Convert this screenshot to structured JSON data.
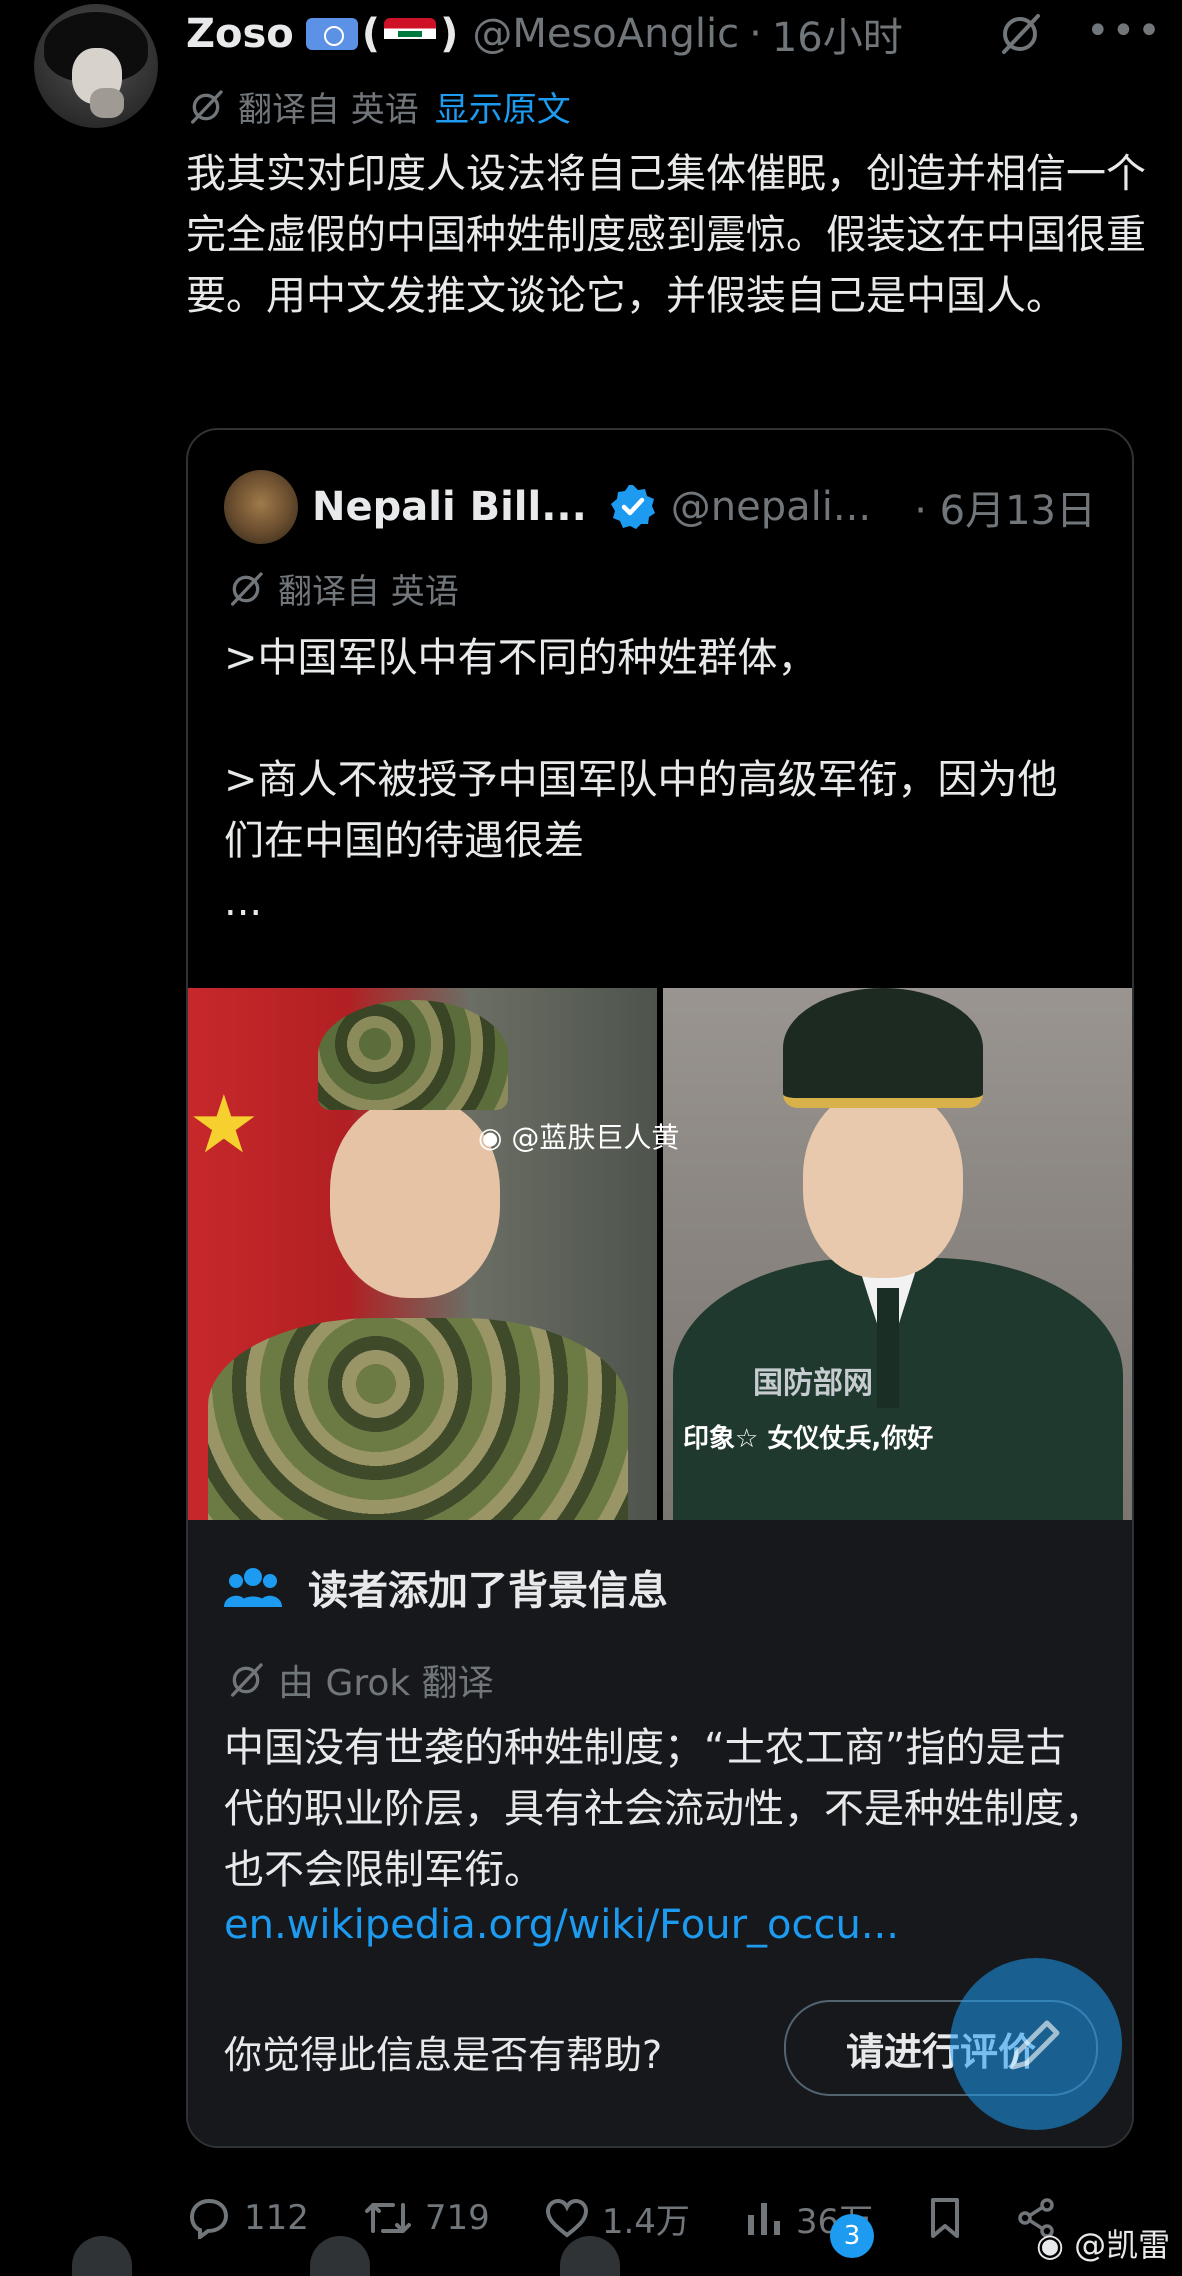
{
  "tweet": {
    "author_name": "Zoso",
    "paren_open": "(",
    "paren_close": ")",
    "handle": "@MesoAnglic",
    "separator": "·",
    "time": "16小时",
    "translated_from": "翻译自 英语",
    "show_original": "显示原文",
    "text": "我其实对印度人设法将自己集体催眠，创造并相信一个完全虚假的中国种姓制度感到震惊。假装这在中国很重要。用中文发推文谈论它，并假装自己是中国人。",
    "flags": [
      "un-flag",
      "iraq-flag"
    ]
  },
  "quote": {
    "author_name": "Nepali Bill...",
    "handle": "@nepali...",
    "time": "· 6月13日",
    "translated_from": "翻译自 英语",
    "lines": [
      ">中国军队中有不同的种姓群体，",
      "",
      ">商人不被授予中国军队中的高级军衔，因为他们在中国的待遇很差",
      "..."
    ],
    "photo_watermark": "@蓝肤巨人黄",
    "right_photo_watermark": "国防部网",
    "right_photo_subtitle": "印象☆ 女仪仗兵,你好"
  },
  "community_note": {
    "header": "读者添加了背景信息",
    "translated_by": "由 Grok 翻译",
    "text": "中国没有世袭的种姓制度；“士农工商”指的是古代的职业阶层，具有社会流动性，不是种姓制度，也不会限制军衔。",
    "link": "en.wikipedia.org/wiki/Four_occu...",
    "helpful_question": "你觉得此信息是否有帮助?",
    "rate_button": "请进行评价"
  },
  "actions": {
    "replies": "112",
    "retweets": "719",
    "likes": "1.4万",
    "views": "36万"
  },
  "nav": {
    "notification_count": "3"
  },
  "overlay": {
    "weibo_corner": "@凯雷"
  },
  "colors": {
    "accent": "#1d9bf0",
    "muted": "#71767b",
    "text": "#e7e9ea",
    "background": "#000000"
  }
}
